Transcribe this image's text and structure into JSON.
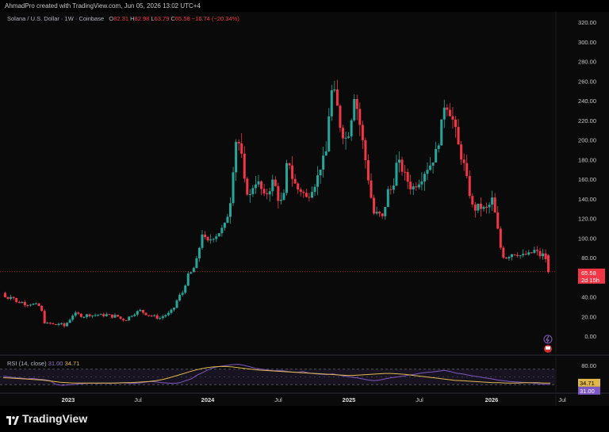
{
  "header": {
    "created_by": "AhmadPro created with TradingView.com, Jun 05, 2026 13:02 UTC+4"
  },
  "legend": {
    "symbol": "Solana / U.S. Dollar · 1W · Coinbase",
    "open_label": "O",
    "open": "82.31",
    "high_label": "H",
    "high": "82.98",
    "low_label": "L",
    "low": "63.79",
    "close_label": "C",
    "close": "65.58",
    "change": "−16.74 (−20.34%)"
  },
  "price_tag": {
    "value": "65.58",
    "countdown": "2d 15h"
  },
  "rsi": {
    "label": "RSI (14, close)",
    "value": "31.00",
    "ma_value": "34.71",
    "ticks": [
      "80.00"
    ]
  },
  "icons": {
    "alert": "lightning-icon",
    "flag": "flag-icon"
  },
  "colors": {
    "up": "#26a69a",
    "down": "#f23645",
    "rsi": "#7e57c2",
    "rsi_ma": "#e0b84a"
  },
  "footer": {
    "logo_text": "TradingView"
  },
  "chart_data": {
    "type": "candlestick",
    "title": "Solana / U.S. Dollar · 1W · Coinbase",
    "y_ticks": [
      "320.00",
      "300.00",
      "280.00",
      "260.00",
      "240.00",
      "220.00",
      "200.00",
      "180.00",
      "160.00",
      "140.00",
      "120.00",
      "100.00",
      "80.00",
      "40.00",
      "20.00",
      "0.00"
    ],
    "ylim": [
      -10,
      325
    ],
    "x_ticks": [
      "2023",
      "Jul",
      "2024",
      "Jul",
      "2025",
      "Jul",
      "2026",
      "Jul"
    ],
    "last_close": 65.58,
    "series": [
      {
        "name": "price_path",
        "points": [
          [
            0,
            44
          ],
          [
            6,
            42
          ],
          [
            12,
            38
          ],
          [
            18,
            42
          ],
          [
            24,
            34
          ],
          [
            30,
            35
          ],
          [
            36,
            32
          ],
          [
            42,
            33
          ],
          [
            48,
            32
          ],
          [
            54,
            30
          ],
          [
            60,
            12
          ],
          [
            66,
            13
          ],
          [
            72,
            11
          ],
          [
            78,
            13
          ],
          [
            84,
            10
          ],
          [
            90,
            16
          ],
          [
            96,
            23
          ],
          [
            102,
            22
          ],
          [
            108,
            20
          ],
          [
            114,
            22
          ],
          [
            120,
            21
          ],
          [
            126,
            22
          ],
          [
            132,
            21
          ],
          [
            138,
            22
          ],
          [
            144,
            20
          ],
          [
            150,
            21
          ],
          [
            156,
            17
          ],
          [
            162,
            17
          ],
          [
            168,
            21
          ],
          [
            174,
            24
          ],
          [
            180,
            26
          ],
          [
            186,
            23
          ],
          [
            192,
            21
          ],
          [
            198,
            20
          ],
          [
            204,
            18
          ],
          [
            210,
            21
          ],
          [
            216,
            23
          ],
          [
            222,
            28
          ],
          [
            228,
            40
          ],
          [
            234,
            45
          ],
          [
            240,
            62
          ],
          [
            246,
            66
          ],
          [
            252,
            80
          ],
          [
            258,
            105
          ],
          [
            264,
            95
          ],
          [
            270,
            100
          ],
          [
            276,
            103
          ],
          [
            282,
            108
          ],
          [
            288,
            115
          ],
          [
            294,
            140
          ],
          [
            300,
            200
          ],
          [
            306,
            195
          ],
          [
            312,
            152
          ],
          [
            318,
            142
          ],
          [
            324,
            158
          ],
          [
            330,
            155
          ],
          [
            336,
            142
          ],
          [
            342,
            148
          ],
          [
            348,
            160
          ],
          [
            354,
            140
          ],
          [
            360,
            135
          ],
          [
            366,
            185
          ],
          [
            372,
            160
          ],
          [
            378,
            150
          ],
          [
            384,
            148
          ],
          [
            390,
            140
          ],
          [
            396,
            150
          ],
          [
            402,
            158
          ],
          [
            408,
            175
          ],
          [
            414,
            185
          ],
          [
            420,
            250
          ],
          [
            426,
            245
          ],
          [
            432,
            215
          ],
          [
            438,
            200
          ],
          [
            444,
            210
          ],
          [
            450,
            248
          ],
          [
            456,
            220
          ],
          [
            462,
            190
          ],
          [
            468,
            158
          ],
          [
            474,
            125
          ],
          [
            480,
            125
          ],
          [
            486,
            120
          ],
          [
            492,
            148
          ],
          [
            498,
            150
          ],
          [
            504,
            180
          ],
          [
            510,
            170
          ],
          [
            516,
            160
          ],
          [
            522,
            150
          ],
          [
            528,
            155
          ],
          [
            534,
            160
          ],
          [
            540,
            170
          ],
          [
            546,
            175
          ],
          [
            552,
            185
          ],
          [
            558,
            205
          ],
          [
            564,
            240
          ],
          [
            570,
            230
          ],
          [
            576,
            215
          ],
          [
            582,
            190
          ],
          [
            588,
            175
          ],
          [
            594,
            150
          ],
          [
            600,
            128
          ],
          [
            606,
            132
          ],
          [
            612,
            130
          ],
          [
            618,
            130
          ],
          [
            624,
            140
          ],
          [
            630,
            112
          ],
          [
            636,
            82
          ],
          [
            642,
            80
          ],
          [
            648,
            84
          ],
          [
            654,
            84
          ],
          [
            660,
            82
          ],
          [
            666,
            83
          ],
          [
            672,
            84
          ],
          [
            678,
            88
          ],
          [
            684,
            82
          ],
          [
            690,
            84
          ],
          [
            694,
            66
          ]
        ]
      },
      {
        "name": "RSI (14, close)",
        "values": [
          52,
          50,
          48,
          47,
          45,
          46,
          44,
          43,
          40,
          30,
          28,
          29,
          30,
          32,
          33,
          34,
          33,
          34,
          33,
          34,
          35,
          34,
          33,
          34,
          36,
          38,
          37,
          35,
          34,
          33,
          35,
          40,
          45,
          55,
          62,
          70,
          75,
          78,
          80,
          82,
          83,
          80,
          76,
          72,
          70,
          68,
          66,
          67,
          65,
          63,
          62,
          64,
          60,
          58,
          57,
          56,
          58,
          55,
          52,
          50,
          48,
          45,
          42,
          40,
          42,
          45,
          48,
          50,
          52,
          55,
          57,
          60,
          62,
          63,
          65,
          67,
          64,
          60,
          58,
          55,
          52,
          50,
          47,
          45,
          42,
          40,
          38,
          37,
          36,
          35,
          34,
          32,
          31,
          31
        ]
      },
      {
        "name": "RSI MA",
        "values": [
          48,
          47,
          46,
          45,
          44,
          43,
          42,
          40,
          38,
          36,
          35,
          34,
          34,
          34,
          34,
          34,
          34,
          34,
          34,
          35,
          35,
          36,
          37,
          38,
          40,
          43,
          47,
          52,
          57,
          62,
          67,
          71,
          74,
          76,
          77,
          77,
          76,
          74,
          72,
          70,
          68,
          67,
          66,
          65,
          64,
          63,
          62,
          61,
          60,
          59,
          58,
          57,
          56,
          55,
          54,
          54,
          55,
          56,
          57,
          58,
          59,
          59,
          58,
          57,
          55,
          53,
          51,
          49,
          47,
          45,
          43,
          41,
          40,
          39,
          38,
          37,
          36,
          35,
          35,
          34,
          34,
          34,
          35,
          35,
          35,
          34,
          34
        ]
      }
    ]
  }
}
